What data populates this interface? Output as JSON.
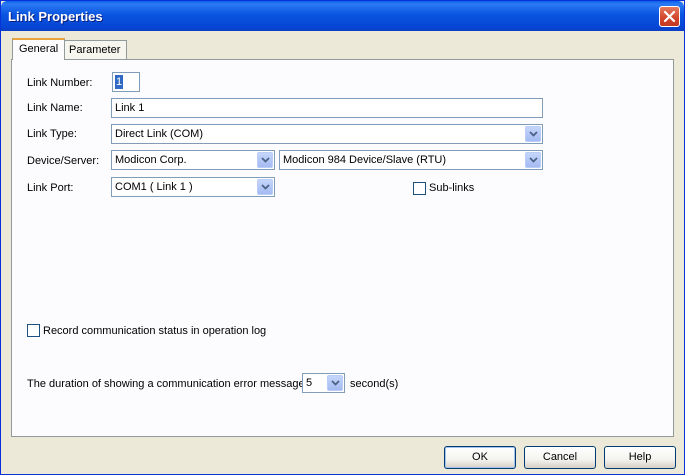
{
  "window": {
    "title": "Link Properties"
  },
  "tabs": [
    {
      "label": "General"
    },
    {
      "label": "Parameter"
    }
  ],
  "form": {
    "link_number": {
      "label": "Link Number:",
      "value": "1"
    },
    "link_name": {
      "label": "Link Name:",
      "value": "Link 1"
    },
    "link_type": {
      "label": "Link Type:",
      "value": "Direct Link (COM)"
    },
    "device_server": {
      "label": "Device/Server:",
      "vendor": "Modicon Corp.",
      "device": "Modicon 984 Device/Slave (RTU)"
    },
    "link_port": {
      "label": "Link Port:",
      "value": "COM1 ( Link 1 )"
    },
    "sub_links": {
      "label": "Sub-links",
      "checked": false
    },
    "record_status": {
      "label": "Record communication status in operation log",
      "checked": false
    },
    "duration": {
      "label": "The duration of showing a communication error message:",
      "value": "5",
      "unit": "second(s)"
    }
  },
  "buttons": {
    "ok": "OK",
    "cancel": "Cancel",
    "help": "Help"
  },
  "colors": {
    "titlebar": "#0b55e0",
    "dialog_bg": "#ece9d8",
    "panel_bg": "#fcfcfe",
    "field_border": "#7f9db9",
    "selection": "#316ac5"
  }
}
